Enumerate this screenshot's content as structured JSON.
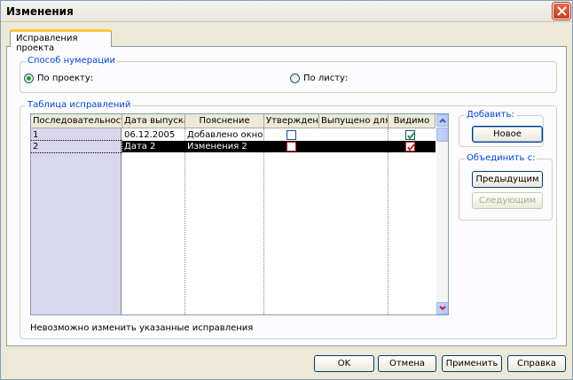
{
  "window": {
    "title": "Изменения"
  },
  "tab": {
    "label": "Исправления проекта"
  },
  "numbering": {
    "legend": "Способ нумерации",
    "option_project": "По проекту:",
    "option_sheet": "По листу:",
    "selected": "project"
  },
  "table": {
    "legend": "Таблица исправлений",
    "columns": [
      "Последовательность",
      "Дата выпуска",
      "Пояснение",
      "Утверждено",
      "Выпущено для",
      "Видимо"
    ],
    "rows": [
      {
        "seq": "1",
        "date": "06.12.2005",
        "note": "Добавлено окно в",
        "approved": false,
        "visible": true
      },
      {
        "seq": "2",
        "date": "Дата 2",
        "note": "Изменения 2",
        "approved": false,
        "visible": true
      }
    ],
    "selected_row": 1
  },
  "add_group": {
    "legend": "Добавить:",
    "new_button": "Новое"
  },
  "merge_group": {
    "legend": "Объединить с:",
    "prev_button": "Предыдущим",
    "next_button": "Следующим"
  },
  "note": "Невозможно изменить указанные исправления",
  "footer": {
    "ok": "OK",
    "cancel": "Отмена",
    "apply": "Применить",
    "help": "Справка"
  }
}
